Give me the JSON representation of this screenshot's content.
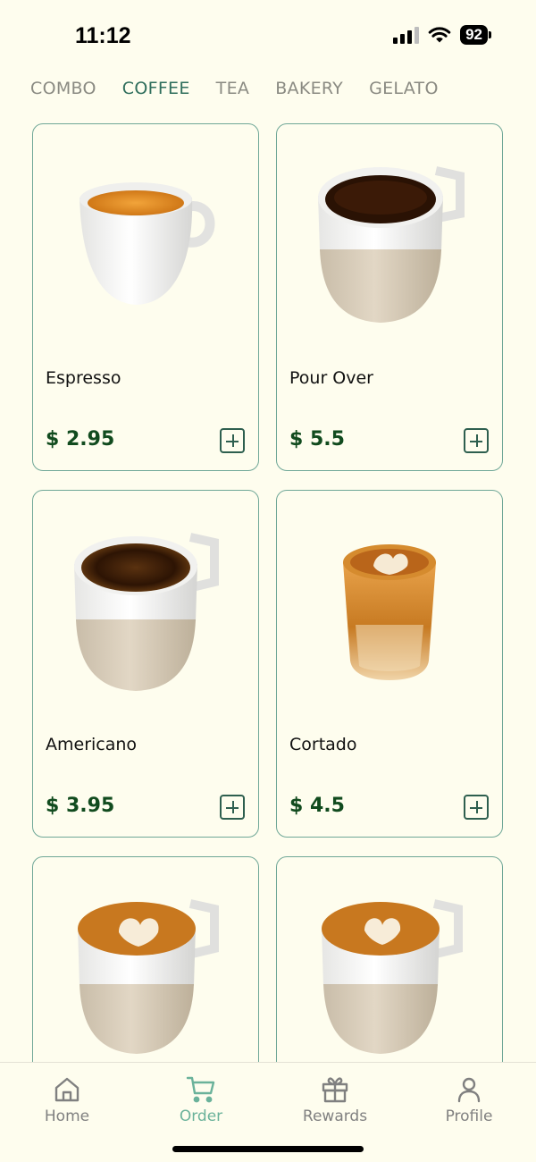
{
  "status_bar": {
    "time": "11:12",
    "battery": "92"
  },
  "tabs": [
    {
      "label": "COMBO",
      "active": false
    },
    {
      "label": "COFFEE",
      "active": true
    },
    {
      "label": "TEA",
      "active": false
    },
    {
      "label": "BAKERY",
      "active": false
    },
    {
      "label": "GELATO",
      "active": false
    }
  ],
  "products": [
    {
      "name": "Espresso",
      "price": "$ 2.95"
    },
    {
      "name": "Pour Over",
      "price": "$ 5.5"
    },
    {
      "name": "Americano",
      "price": "$ 3.95"
    },
    {
      "name": "Cortado",
      "price": "$ 4.5"
    },
    {
      "name": "",
      "price": ""
    },
    {
      "name": "",
      "price": ""
    }
  ],
  "bottom_nav": [
    {
      "label": "Home",
      "icon": "home-icon",
      "active": false
    },
    {
      "label": "Order",
      "icon": "cart-icon",
      "active": true
    },
    {
      "label": "Rewards",
      "icon": "gift-icon",
      "active": false
    },
    {
      "label": "Profile",
      "icon": "person-icon",
      "active": false
    }
  ],
  "colors": {
    "background": "#fefdee",
    "accent": "#2f6e5c",
    "price": "#114b1e",
    "card_border": "#6fa797",
    "nav_active": "#6ab29a"
  }
}
